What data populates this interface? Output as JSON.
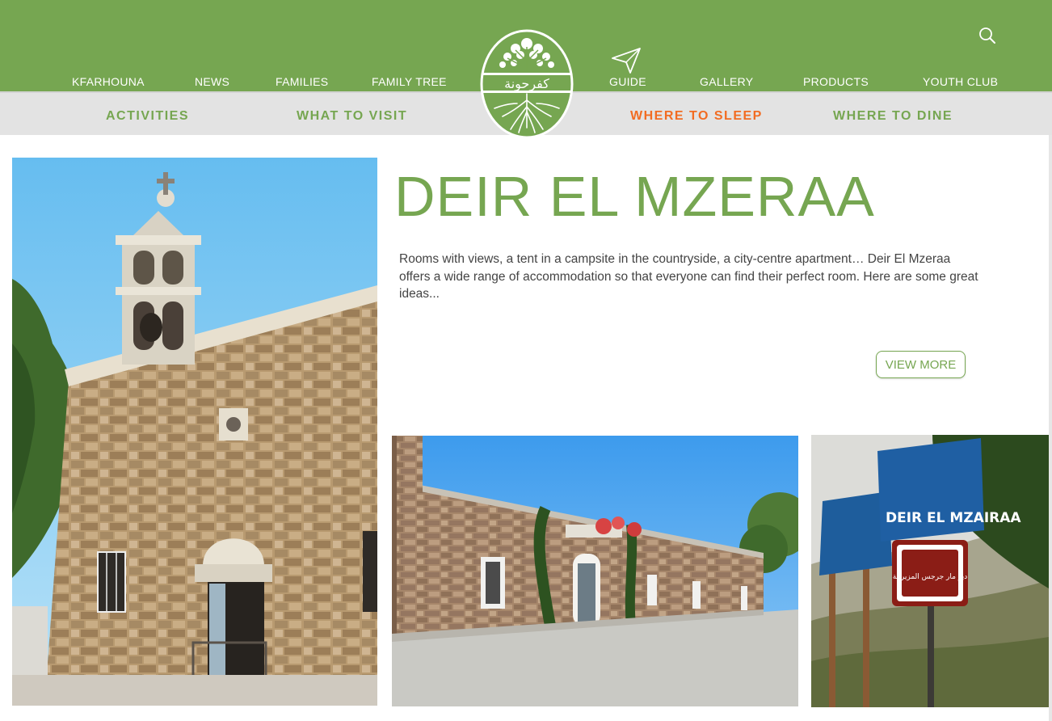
{
  "header": {
    "nav": [
      "KFARHOUNA",
      "NEWS",
      "FAMILIES",
      "FAMILY TREE",
      "GUIDE",
      "GALLERY",
      "PRODUCTS",
      "YOUTH CLUB"
    ],
    "logo_text": "كفرحونة"
  },
  "subnav": {
    "items": [
      "ACTIVITIES",
      "WHAT TO VISIT",
      "WHERE TO SLEEP",
      "WHERE TO DINE"
    ],
    "active": "WHERE TO SLEEP"
  },
  "main": {
    "title": "DEIR EL MZERAA",
    "description": "Rooms with views, a tent in a campsite in the countryside, a city-centre apartment… Deir El Mzeraa offers a wide range of accommodation so that everyone can find their perfect room. Here are some great ideas...",
    "view_more": "VIEW MORE"
  },
  "photos": {
    "sign_text_1": "DEIR EL MZAIRAA",
    "sign_text_2": "دير مار جرجس المزيرعة"
  },
  "colors": {
    "brand_green": "#76a651",
    "active_orange": "#f26c22",
    "subbar_gray": "#e3e3e3"
  }
}
